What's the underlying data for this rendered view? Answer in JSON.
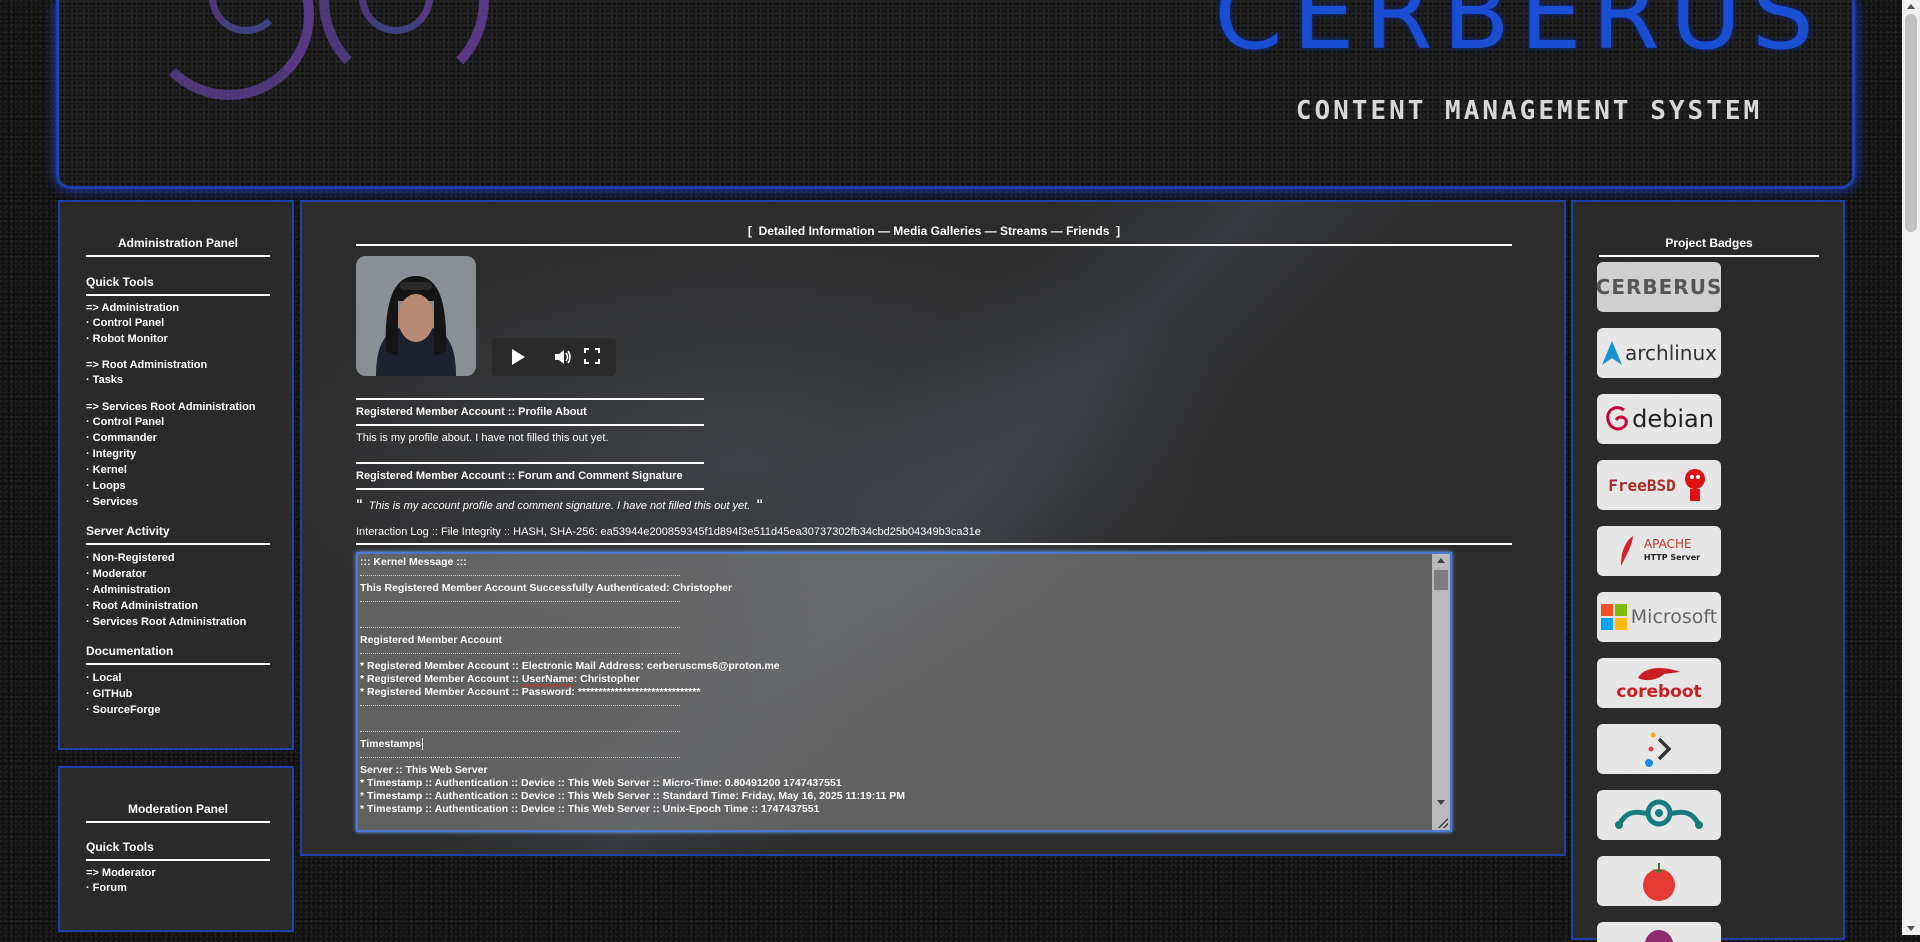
{
  "banner": {
    "logo_text": "CERBERUS",
    "subtitle": "CONTENT MANAGEMENT SYSTEM"
  },
  "admin_panel": {
    "title": "Administration Panel",
    "quick_tools_title": "Quick Tools",
    "admin_link": "=> Administration",
    "admin_items": [
      "Control Panel",
      "Robot Monitor"
    ],
    "root_admin_link": "=> Root Administration",
    "root_admin_items": [
      "Tasks"
    ],
    "services_root_link": "=> Services Root Administration",
    "services_items": [
      "Control Panel",
      "Commander",
      "Integrity",
      "Kernel",
      "Loops",
      "Services"
    ],
    "server_activity_title": "Server Activity",
    "server_activity_items": [
      "Non-Registered",
      "Moderator",
      "Administration",
      "Root Administration",
      "Services Root Administration"
    ],
    "documentation_title": "Documentation",
    "documentation_items": [
      "Local",
      "GITHub",
      "SourceForge"
    ]
  },
  "moderation_panel": {
    "title": "Moderation Panel",
    "quick_tools_title": "Quick Tools",
    "moderator_link": "=> Moderator",
    "items": [
      "Forum"
    ]
  },
  "center": {
    "tabs_open": "[",
    "tabs_close": "]",
    "separator": "—",
    "tabs": [
      "Detailed Information",
      "Media Galleries",
      "Streams",
      "Friends"
    ],
    "profile_about_title": "Registered Member Account :: Profile About",
    "profile_about_text": "This is my profile about. I have not filled this out yet.",
    "signature_title": "Registered Member Account :: Forum and Comment Signature",
    "signature_text": "This is my account profile and comment signature. I have not filled this out yet.",
    "quote_open": "\"",
    "quote_close": "\"",
    "integrity_line": "Interaction Log :: File Integrity :: HASH, SHA-256: ea53944e200859345f1d894f3e511d45ea30737302fb34cbd25b04349b3ca31e",
    "kernel": {
      "header": "::: Kernel Message :::",
      "auth_message": "This Registered Member Account Successfully Authenticated: Christopher",
      "account_title": "Registered Member Account",
      "email_line": "* Registered Member Account :: Electronic Mail Address: cerberuscms6@proton.me",
      "username_prefix": "* Registered Member Account :: ",
      "username_word": "UserName",
      "username_suffix": ": Christopher",
      "password_line": "* Registered Member Account :: Password: ******************************",
      "timestamps_title": "Timestamps",
      "server_title": "Server :: This Web Server",
      "ts_micro": "* Timestamp :: Authentication :: Device :: This Web Server :: Micro-Time: 0.80491200 1747437551",
      "ts_standard": "* Timestamp :: Authentication :: Device :: This Web Server :: Standard Time: Friday, May 16, 2025 11:19:11 PM",
      "ts_unix": "* Timestamp :: Authentication :: Device :: This Web Server :: Unix-Epoch Time :: 1747437551"
    }
  },
  "badges_panel": {
    "title": "Project Badges",
    "badges": [
      {
        "name": "CERBERUS",
        "icon": "cerberus-badge"
      },
      {
        "name": "archlinux",
        "icon": "archlinux-badge"
      },
      {
        "name": "debian",
        "icon": "debian-badge"
      },
      {
        "name": "FreeBSD",
        "icon": "freebsd-badge"
      },
      {
        "name": "APACHE",
        "sub": "HTTP Server",
        "icon": "apache-badge"
      },
      {
        "name": "Microsoft",
        "icon": "microsoft-badge"
      },
      {
        "name": "coreboot",
        "icon": "coreboot-badge"
      },
      {
        "name": "",
        "icon": "prompt-badge"
      },
      {
        "name": "",
        "icon": "lineage-badge"
      },
      {
        "name": "",
        "icon": "tomato-badge"
      },
      {
        "name": "",
        "icon": "partial-badge"
      }
    ]
  },
  "colors": {
    "panel_border": "#1e3fae",
    "background": "#151515",
    "text": "#ffffff",
    "banner_logo": "#1a4fd4"
  }
}
